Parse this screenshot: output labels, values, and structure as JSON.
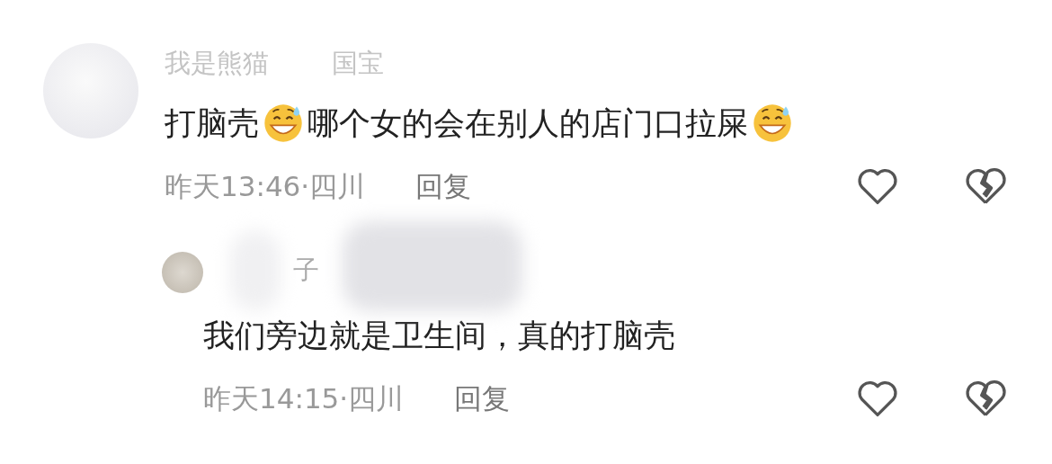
{
  "comments": [
    {
      "kind": "comment",
      "name_parts": [
        "我是熊猫",
        "国宝"
      ],
      "content": [
        {
          "kind": "text",
          "text": "打脑壳"
        },
        {
          "kind": "emoji"
        },
        {
          "kind": "text",
          "text": "哪个女的会在别人的店门口拉屎"
        },
        {
          "kind": "emoji"
        }
      ],
      "time": "昨天13:46·四川",
      "reply": "回复",
      "liked": false,
      "disliked": false
    },
    {
      "kind": "reply",
      "name_parts": [
        "子"
      ],
      "content": [
        {
          "kind": "text",
          "text": "我们旁边就是卫生间，真的打脑壳"
        }
      ],
      "time": "昨天14:15·四川",
      "reply": "回复",
      "liked": false,
      "disliked": false
    }
  ]
}
